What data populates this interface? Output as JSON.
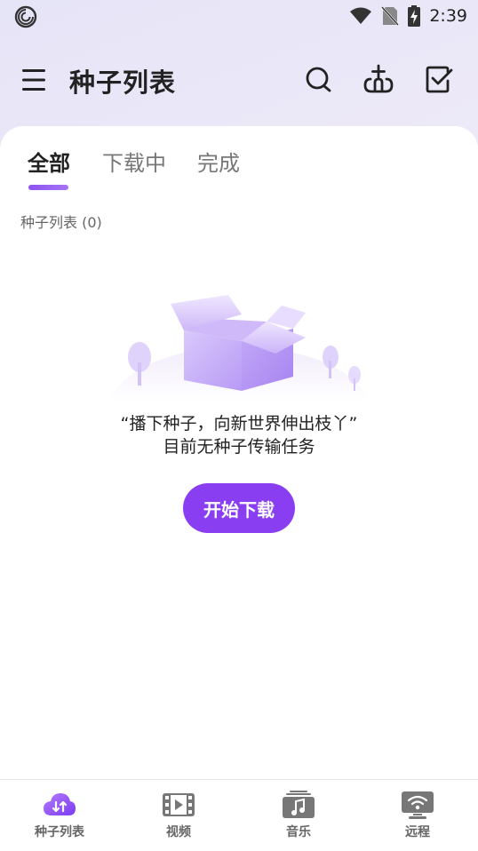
{
  "status_bar": {
    "time": "2:39",
    "icons": [
      "app-logo-icon",
      "wifi-icon",
      "no-sim-icon",
      "battery-charging-icon"
    ]
  },
  "header": {
    "title": "种子列表",
    "icons": [
      "menu-icon",
      "search-icon",
      "add-torrent-icon",
      "select-icon"
    ]
  },
  "tabs": [
    {
      "label": "全部",
      "active": true
    },
    {
      "label": "下载中",
      "active": false
    },
    {
      "label": "完成",
      "active": false
    }
  ],
  "list": {
    "title": "种子列表",
    "count": "(0)"
  },
  "empty_state": {
    "quote": "“播下种子，向新世界伸出枝丫”",
    "message": "目前无种子传输任务",
    "button_label": "开始下载",
    "illustration": "empty-box-icon"
  },
  "colors": {
    "accent": "#8a3ef2",
    "accent_light": "#a574f7",
    "background": "#eeeaf8",
    "card": "#ffffff"
  },
  "bottom_nav": [
    {
      "label": "种子列表",
      "icon": "cloud-transfer-icon",
      "active": true
    },
    {
      "label": "视频",
      "icon": "film-icon",
      "active": false
    },
    {
      "label": "音乐",
      "icon": "music-icon",
      "active": false
    },
    {
      "label": "远程",
      "icon": "remote-wifi-icon",
      "active": false
    }
  ]
}
